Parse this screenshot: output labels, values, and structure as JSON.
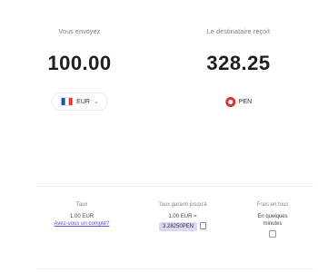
{
  "converter": {
    "from": {
      "caption": "Vous envoyez",
      "amount": "100.00",
      "currency": "EUR",
      "chevron": "⌄",
      "flag_colors": [
        "#1f4fae",
        "#ffffff",
        "#e0383e"
      ]
    },
    "to": {
      "caption": "Le destinataire reçoit",
      "amount": "328.25",
      "currency": "PEN"
    }
  },
  "details": {
    "rate": {
      "title": "Taux",
      "value": "1.00 EUR",
      "link": "Avez-vous un compte?"
    },
    "guaranteed": {
      "title": "Taux garanti jusqu'à",
      "value": "1.00 EUR =",
      "chip": "3.28250PEN"
    },
    "fees": {
      "title": "Frais en tous",
      "line1": "En quelques",
      "line2": "minutes"
    }
  }
}
